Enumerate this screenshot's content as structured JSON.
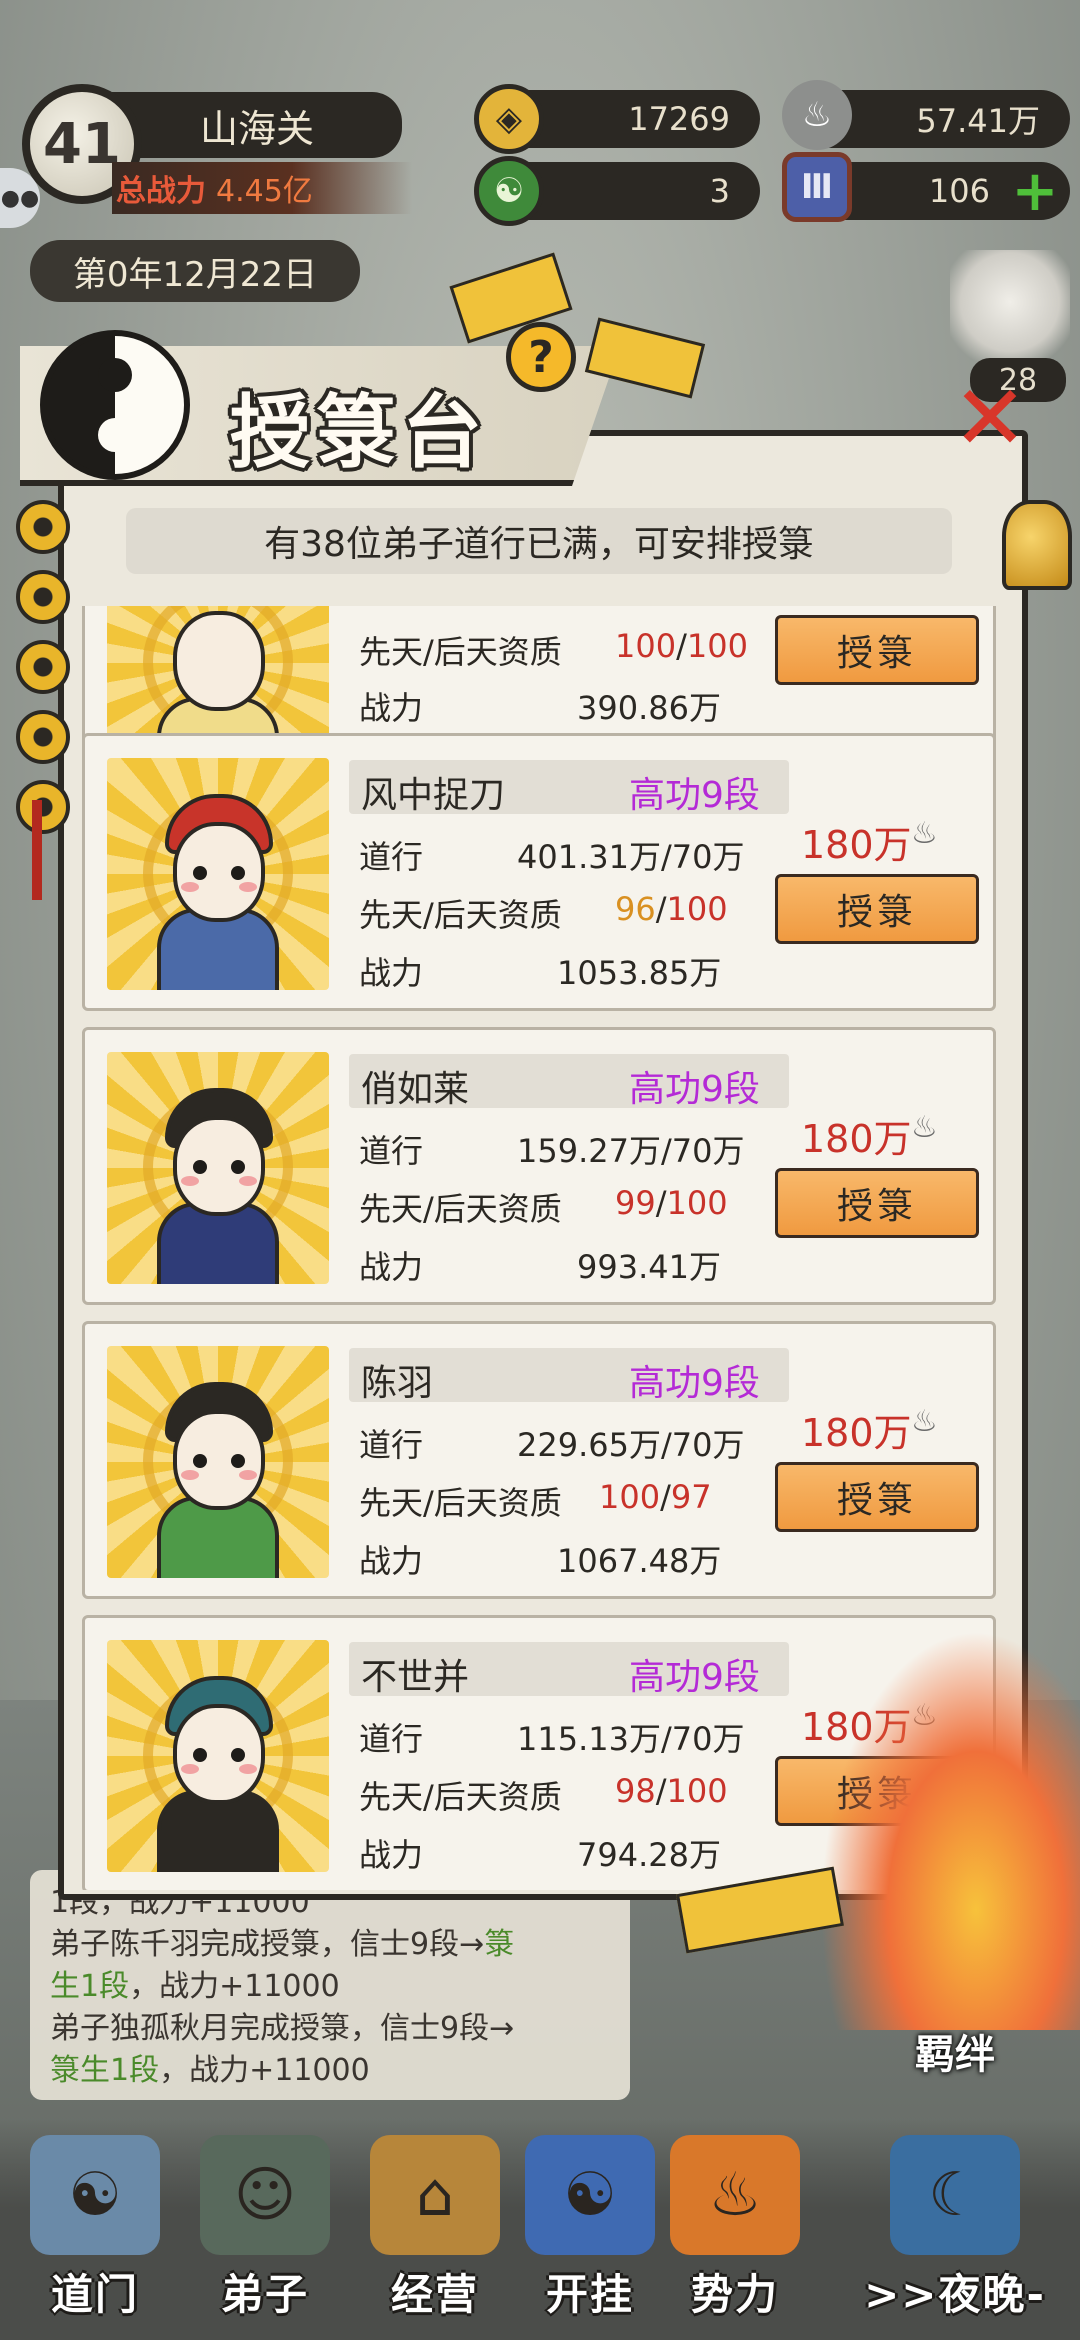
{
  "hud": {
    "level": "41",
    "location": "山海关",
    "total_power_label": "总战力",
    "total_power_value": "4.45亿",
    "coins": "17269",
    "spirit": "57.41万",
    "jade": "3",
    "tokens": "106",
    "add_symbol": "+",
    "date": "第0年12月22日",
    "side_count": "28"
  },
  "dialog": {
    "title": "授箓台",
    "help": "?",
    "notice": "有38位弟子道行已满，可安排授箓",
    "labels": {
      "cultivation": "道行",
      "aptitude": "先天/后天资质",
      "power": "战力",
      "grant": "授箓"
    }
  },
  "partial_card": {
    "aptitude_innate": "100",
    "aptitude_sep": "/",
    "aptitude_acquired": "100",
    "power": "390.86万",
    "grant": "授箓"
  },
  "disciples": [
    {
      "name": "风中捉刀",
      "rank": "高功9段",
      "cultivation": "401.31万/70万",
      "aptitude_innate": "96",
      "aptitude_sep": "/",
      "aptitude_acquired": "100",
      "power": "1053.85万",
      "cost": "180万"
    },
    {
      "name": "俏如莱",
      "rank": "高功9段",
      "cultivation": "159.27万/70万",
      "aptitude_innate": "99",
      "aptitude_sep": "/",
      "aptitude_acquired": "100",
      "power": "993.41万",
      "cost": "180万"
    },
    {
      "name": "陈羽",
      "rank": "高功9段",
      "cultivation": "229.65万/70万",
      "aptitude_innate": "100",
      "aptitude_sep": "/",
      "aptitude_acquired": "97",
      "power": "1067.48万",
      "cost": "180万"
    },
    {
      "name": "不世并",
      "rank": "高功9段",
      "cultivation": "115.13万/70万",
      "aptitude_innate": "98",
      "aptitude_sep": "/",
      "aptitude_acquired": "100",
      "power": "794.28万",
      "cost": "180万"
    }
  ],
  "log": [
    {
      "pre": "1段，战力+11000",
      "green": "",
      "post": ""
    },
    {
      "pre": "弟子陈千羽完成授箓，信士9段→",
      "green": "箓",
      "post": ""
    },
    {
      "pre": "",
      "green": "生1段",
      "post": "，战力+11000"
    },
    {
      "pre": "弟子独孤秋月完成授箓，信士9段→",
      "green": "",
      "post": ""
    },
    {
      "pre": "",
      "green": "箓生1段",
      "post": "，战力+11000"
    }
  ],
  "bond": "羁绊",
  "nav": [
    {
      "label": "道门"
    },
    {
      "label": "弟子"
    },
    {
      "label": "经营"
    },
    {
      "label": "开挂"
    },
    {
      "label": "势力"
    },
    {
      "label": ">>夜晚-"
    }
  ],
  "colors": {
    "rank_purple": "#b42ad6",
    "value_red": "#c8322a",
    "value_orange": "#d99021",
    "button_orange": "#f09a40",
    "avatar_gold": "#f2c53a",
    "log_green": "#4a8a2a"
  },
  "icons": {
    "coins": "coin-icon",
    "spirit": "incense-icon",
    "jade": "jade-icon",
    "tokens": "token-icon",
    "cost": "incense-icon"
  }
}
